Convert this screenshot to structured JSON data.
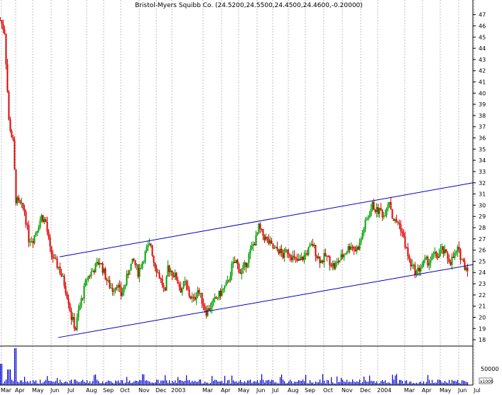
{
  "chart_data": {
    "type": "candlestick",
    "title": "Bristol-Myers Squibb Co. (24.5200,24.5500,24.4500,24.4600,-0.20000)",
    "y_ticks": [
      18,
      19,
      20,
      21,
      22,
      23,
      24,
      25,
      26,
      27,
      28,
      29,
      30,
      31,
      32,
      33,
      34,
      35,
      36,
      37,
      38,
      39,
      40,
      41,
      42,
      43,
      44,
      45,
      46,
      47
    ],
    "ylim": [
      17.5,
      47.8
    ],
    "x_labels": [
      "Mar",
      "Apr",
      "May",
      "Jun",
      "Jul",
      "Aug",
      "Sep",
      "Oct",
      "Nov",
      "Dec",
      "2003",
      "Mar",
      "Apr",
      "May",
      "Jun",
      "Jul",
      "Aug",
      "Sep",
      "Oct",
      "Nov",
      "Dec",
      "2004",
      "Mar",
      "Apr",
      "May",
      "Jun",
      "Jul"
    ],
    "volume_tick_label": "50000",
    "volume_unit_label": "x1000",
    "price_path": [
      [
        0,
        46.5
      ],
      [
        6,
        45.5
      ],
      [
        12,
        37.5
      ],
      [
        18,
        35.5
      ],
      [
        22,
        30.5
      ],
      [
        28,
        30
      ],
      [
        34,
        29.5
      ],
      [
        40,
        27
      ],
      [
        46,
        27
      ],
      [
        52,
        28
      ],
      [
        58,
        29
      ],
      [
        64,
        28.5
      ],
      [
        70,
        26
      ],
      [
        76,
        25
      ],
      [
        82,
        24.5
      ],
      [
        90,
        23
      ],
      [
        96,
        21.5
      ],
      [
        100,
        20
      ],
      [
        106,
        19
      ],
      [
        110,
        20.5
      ],
      [
        116,
        22
      ],
      [
        122,
        23.5
      ],
      [
        128,
        24
      ],
      [
        134,
        24.5
      ],
      [
        140,
        25
      ],
      [
        146,
        24
      ],
      [
        152,
        23
      ],
      [
        158,
        22.5
      ],
      [
        164,
        23
      ],
      [
        170,
        22
      ],
      [
        176,
        23
      ],
      [
        182,
        24.5
      ],
      [
        188,
        25
      ],
      [
        194,
        24
      ],
      [
        200,
        25
      ],
      [
        206,
        26
      ],
      [
        212,
        26.5
      ],
      [
        216,
        25
      ],
      [
        222,
        24
      ],
      [
        228,
        23
      ],
      [
        232,
        22
      ],
      [
        236,
        24.5
      ],
      [
        242,
        24
      ],
      [
        248,
        23.5
      ],
      [
        254,
        22.5
      ],
      [
        260,
        23
      ],
      [
        266,
        22
      ],
      [
        272,
        21.5
      ],
      [
        278,
        22.5
      ],
      [
        284,
        21.5
      ],
      [
        290,
        20.5
      ],
      [
        296,
        21
      ],
      [
        302,
        21.5
      ],
      [
        308,
        22
      ],
      [
        314,
        22.5
      ],
      [
        320,
        23
      ],
      [
        326,
        24.5
      ],
      [
        332,
        25
      ],
      [
        338,
        24
      ],
      [
        344,
        24.5
      ],
      [
        350,
        25.5
      ],
      [
        356,
        26.5
      ],
      [
        360,
        27
      ],
      [
        364,
        28
      ],
      [
        368,
        27.5
      ],
      [
        374,
        27
      ],
      [
        380,
        26.5
      ],
      [
        386,
        26
      ],
      [
        392,
        26
      ],
      [
        398,
        25.5
      ],
      [
        404,
        26
      ],
      [
        410,
        25.5
      ],
      [
        416,
        25
      ],
      [
        422,
        25
      ],
      [
        428,
        25.5
      ],
      [
        434,
        26
      ],
      [
        440,
        26.5
      ],
      [
        446,
        25.5
      ],
      [
        452,
        25
      ],
      [
        458,
        25.5
      ],
      [
        464,
        25
      ],
      [
        470,
        24.5
      ],
      [
        476,
        25
      ],
      [
        482,
        25.5
      ],
      [
        488,
        26
      ],
      [
        494,
        26.5
      ],
      [
        500,
        26
      ],
      [
        506,
        26.5
      ],
      [
        512,
        28
      ],
      [
        518,
        29
      ],
      [
        524,
        30
      ],
      [
        530,
        29.5
      ],
      [
        536,
        29.5
      ],
      [
        540,
        29
      ],
      [
        544,
        30
      ],
      [
        548,
        30.5
      ],
      [
        552,
        29
      ],
      [
        556,
        28.5
      ],
      [
        560,
        28.5
      ],
      [
        564,
        28
      ],
      [
        568,
        27
      ],
      [
        572,
        26
      ],
      [
        576,
        25
      ],
      [
        580,
        24.5
      ],
      [
        586,
        24
      ],
      [
        592,
        24.5
      ],
      [
        598,
        25
      ],
      [
        604,
        25
      ],
      [
        610,
        25.5
      ],
      [
        616,
        25.5
      ],
      [
        622,
        26
      ],
      [
        628,
        25.5
      ],
      [
        634,
        25
      ],
      [
        640,
        25.5
      ],
      [
        644,
        26
      ],
      [
        648,
        25.5
      ],
      [
        654,
        24.6
      ],
      [
        658,
        24.46
      ]
    ],
    "channel_lines": [
      {
        "x1": 84,
        "y1": 25.4,
        "x2": 666,
        "y2": 32.0
      },
      {
        "x1": 82,
        "y1": 18.2,
        "x2": 666,
        "y2": 24.7
      }
    ],
    "colors": {
      "up": "#00a000",
      "down": "#e00000",
      "volume": "#0000cc",
      "channel": "#0000c0",
      "grid": "#b0b0b0"
    }
  }
}
